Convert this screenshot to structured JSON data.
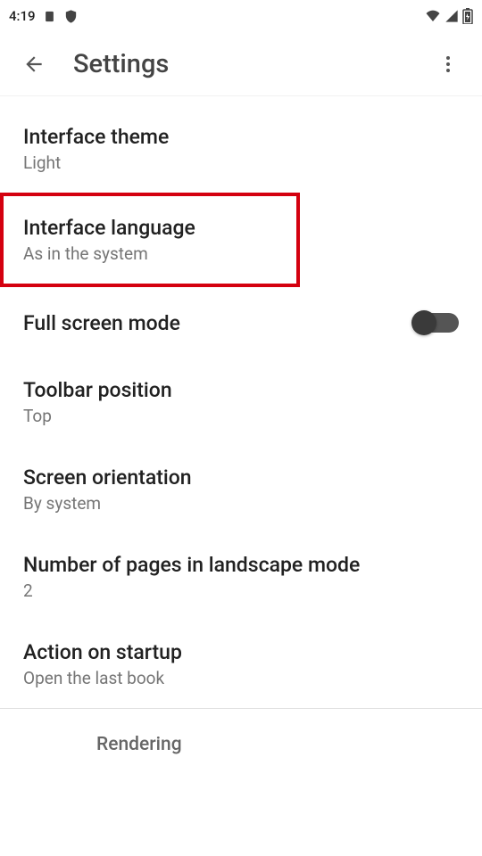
{
  "statusbar": {
    "time": "4:19"
  },
  "appbar": {
    "title": "Settings"
  },
  "settings": {
    "theme": {
      "title": "Interface theme",
      "value": "Light"
    },
    "language": {
      "title": "Interface language",
      "value": "As in the system"
    },
    "fullscreen": {
      "title": "Full screen mode"
    },
    "toolbar": {
      "title": "Toolbar position",
      "value": "Top"
    },
    "orientation": {
      "title": "Screen orientation",
      "value": "By system"
    },
    "pages_landscape": {
      "title": "Number of pages in landscape mode",
      "value": "2"
    },
    "startup": {
      "title": "Action on startup",
      "value": "Open the last book"
    }
  },
  "section": {
    "rendering": "Rendering"
  }
}
